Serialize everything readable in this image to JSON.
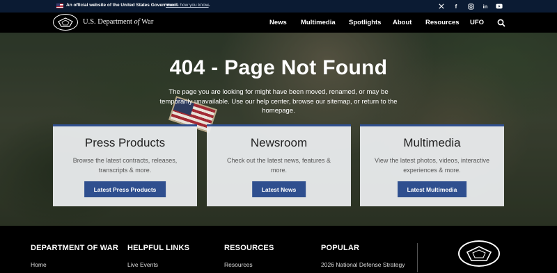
{
  "banner": {
    "official_text": "An official website of the United States Government",
    "link_text": "Here's how you know",
    "social": [
      "x-icon",
      "facebook-icon",
      "instagram-icon",
      "linkedin-icon",
      "youtube-icon"
    ]
  },
  "header": {
    "brand_prefix": "U.S. Department ",
    "brand_of": "of",
    "brand_suffix": " War",
    "nav": [
      "News",
      "Multimedia",
      "Spotlights",
      "About",
      "Resources",
      "UFO"
    ]
  },
  "hero": {
    "title": "404 - Page Not Found",
    "subtitle": "The page you are looking for might have been moved, renamed, or may be temporarily unavailable. Use our help center, browse our sitemap, or return to the homepage."
  },
  "cards": [
    {
      "title": "Press Products",
      "desc": "Browse the latest contracts, releases, transcripts & more.",
      "button": "Latest Press Products"
    },
    {
      "title": "Newsroom",
      "desc": "Check out the latest news, features & more.",
      "button": "Latest News"
    },
    {
      "title": "Multimedia",
      "desc": "View the latest photos, videos, interactive experiences & more.",
      "button": "Latest Multimedia"
    }
  ],
  "footer": {
    "columns": [
      {
        "heading": "DEPARTMENT OF WAR",
        "first_link": "Home"
      },
      {
        "heading": "HELPFUL LINKS",
        "first_link": "Live Events"
      },
      {
        "heading": "RESOURCES",
        "first_link": "Resources"
      },
      {
        "heading": "POPULAR",
        "first_link": "2026 National Defense Strategy"
      }
    ]
  },
  "colors": {
    "accent": "#2f4f8f",
    "banner_bg": "#0b1b33"
  }
}
